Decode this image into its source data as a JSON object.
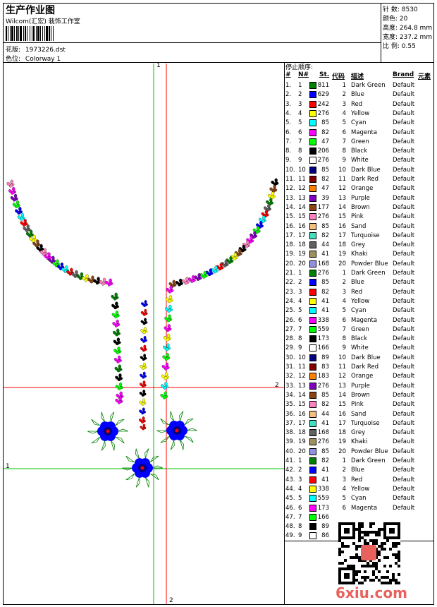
{
  "header": {
    "title": "生产作业图",
    "company": "Wilcom(汇宏) 栽饰工作室",
    "design_label": "花版:",
    "design_value": "1973226.dst",
    "colorway_label": "色位:",
    "colorway_value": "Colorway 1"
  },
  "stats": {
    "stitches_label": "针 数:",
    "stitches_value": "8530",
    "colors_label": "颜色:",
    "colors_value": "20",
    "height_label": "高度:",
    "height_value": "264.8 mm",
    "width_label": "宽度:",
    "width_value": "237.2 mm",
    "scale_label": "比 例:",
    "scale_value": "0.55"
  },
  "axes": {
    "v1": "1",
    "h2": "2",
    "h1": "1",
    "v2": "2"
  },
  "table": {
    "title": "停止顺序:",
    "headers": [
      "#",
      "N#",
      "St.",
      "代码",
      "描述",
      "Brand",
      "元素"
    ],
    "rows": [
      {
        "no": "1.",
        "n": "1",
        "st": "811",
        "code": "1",
        "desc": "Dark Green",
        "brand": "Default",
        "color": "#008000"
      },
      {
        "no": "2.",
        "n": "2",
        "st": "629",
        "code": "2",
        "desc": "Blue",
        "brand": "Default",
        "color": "#0000ff"
      },
      {
        "no": "3.",
        "n": "3",
        "st": "242",
        "code": "3",
        "desc": "Red",
        "brand": "Default",
        "color": "#ff0000"
      },
      {
        "no": "4.",
        "n": "4",
        "st": "276",
        "code": "4",
        "desc": "Yellow",
        "brand": "Default",
        "color": "#ffff00"
      },
      {
        "no": "5.",
        "n": "5",
        "st": "85",
        "code": "5",
        "desc": "Cyan",
        "brand": "Default",
        "color": "#00ffff"
      },
      {
        "no": "6.",
        "n": "6",
        "st": "82",
        "code": "6",
        "desc": "Magenta",
        "brand": "Default",
        "color": "#ff00ff"
      },
      {
        "no": "7.",
        "n": "7",
        "st": "47",
        "code": "7",
        "desc": "Green",
        "brand": "Default",
        "color": "#00ff00"
      },
      {
        "no": "8.",
        "n": "8",
        "st": "206",
        "code": "8",
        "desc": "Black",
        "brand": "Default",
        "color": "#000000"
      },
      {
        "no": "9.",
        "n": "9",
        "st": "276",
        "code": "9",
        "desc": "White",
        "brand": "Default",
        "color": "#ffffff"
      },
      {
        "no": "10.",
        "n": "10",
        "st": "85",
        "code": "10",
        "desc": "Dark Blue",
        "brand": "Default",
        "color": "#000080"
      },
      {
        "no": "11.",
        "n": "11",
        "st": "82",
        "code": "11",
        "desc": "Dark Red",
        "brand": "Default",
        "color": "#800000"
      },
      {
        "no": "12.",
        "n": "12",
        "st": "47",
        "code": "12",
        "desc": "Orange",
        "brand": "Default",
        "color": "#ff8000"
      },
      {
        "no": "13.",
        "n": "13",
        "st": "39",
        "code": "13",
        "desc": "Purple",
        "brand": "Default",
        "color": "#8000c0"
      },
      {
        "no": "14.",
        "n": "14",
        "st": "177",
        "code": "14",
        "desc": "Brown",
        "brand": "Default",
        "color": "#8b4513"
      },
      {
        "no": "15.",
        "n": "15",
        "st": "276",
        "code": "15",
        "desc": "Pink",
        "brand": "Default",
        "color": "#ff80c0"
      },
      {
        "no": "16.",
        "n": "16",
        "st": "85",
        "code": "16",
        "desc": "Sand",
        "brand": "Default",
        "color": "#f4c080"
      },
      {
        "no": "17.",
        "n": "17",
        "st": "82",
        "code": "17",
        "desc": "Turquoise",
        "brand": "Default",
        "color": "#40e0c0"
      },
      {
        "no": "18.",
        "n": "18",
        "st": "44",
        "code": "18",
        "desc": "Grey",
        "brand": "Default",
        "color": "#606060"
      },
      {
        "no": "19.",
        "n": "19",
        "st": "41",
        "code": "19",
        "desc": "Khaki",
        "brand": "Default",
        "color": "#a09060"
      },
      {
        "no": "20.",
        "n": "20",
        "st": "168",
        "code": "20",
        "desc": "Powder Blue",
        "brand": "Default",
        "color": "#9090e0"
      },
      {
        "no": "21.",
        "n": "1",
        "st": "276",
        "code": "1",
        "desc": "Dark Green",
        "brand": "Default",
        "color": "#008000"
      },
      {
        "no": "22.",
        "n": "2",
        "st": "85",
        "code": "2",
        "desc": "Blue",
        "brand": "Default",
        "color": "#0000ff"
      },
      {
        "no": "23.",
        "n": "3",
        "st": "82",
        "code": "3",
        "desc": "Red",
        "brand": "Default",
        "color": "#ff0000"
      },
      {
        "no": "24.",
        "n": "4",
        "st": "41",
        "code": "4",
        "desc": "Yellow",
        "brand": "Default",
        "color": "#ffff00"
      },
      {
        "no": "25.",
        "n": "5",
        "st": "41",
        "code": "5",
        "desc": "Cyan",
        "brand": "Default",
        "color": "#00ffff"
      },
      {
        "no": "26.",
        "n": "6",
        "st": "338",
        "code": "6",
        "desc": "Magenta",
        "brand": "Default",
        "color": "#ff00ff"
      },
      {
        "no": "27.",
        "n": "7",
        "st": "559",
        "code": "7",
        "desc": "Green",
        "brand": "Default",
        "color": "#00ff00"
      },
      {
        "no": "28.",
        "n": "8",
        "st": "173",
        "code": "8",
        "desc": "Black",
        "brand": "Default",
        "color": "#000000"
      },
      {
        "no": "29.",
        "n": "9",
        "st": "166",
        "code": "9",
        "desc": "White",
        "brand": "Default",
        "color": "#ffffff"
      },
      {
        "no": "30.",
        "n": "10",
        "st": "89",
        "code": "10",
        "desc": "Dark Blue",
        "brand": "Default",
        "color": "#000080"
      },
      {
        "no": "31.",
        "n": "11",
        "st": "83",
        "code": "11",
        "desc": "Dark Red",
        "brand": "Default",
        "color": "#800000"
      },
      {
        "no": "32.",
        "n": "12",
        "st": "183",
        "code": "12",
        "desc": "Orange",
        "brand": "Default",
        "color": "#ff8000"
      },
      {
        "no": "33.",
        "n": "13",
        "st": "276",
        "code": "13",
        "desc": "Purple",
        "brand": "Default",
        "color": "#8000c0"
      },
      {
        "no": "34.",
        "n": "14",
        "st": "85",
        "code": "14",
        "desc": "Brown",
        "brand": "Default",
        "color": "#8b4513"
      },
      {
        "no": "35.",
        "n": "15",
        "st": "82",
        "code": "15",
        "desc": "Pink",
        "brand": "Default",
        "color": "#ff80c0"
      },
      {
        "no": "36.",
        "n": "16",
        "st": "44",
        "code": "16",
        "desc": "Sand",
        "brand": "Default",
        "color": "#f4c080"
      },
      {
        "no": "37.",
        "n": "17",
        "st": "41",
        "code": "17",
        "desc": "Turquoise",
        "brand": "Default",
        "color": "#40e0c0"
      },
      {
        "no": "38.",
        "n": "18",
        "st": "168",
        "code": "18",
        "desc": "Grey",
        "brand": "Default",
        "color": "#606060"
      },
      {
        "no": "39.",
        "n": "19",
        "st": "276",
        "code": "19",
        "desc": "Khaki",
        "brand": "Default",
        "color": "#a09060"
      },
      {
        "no": "40.",
        "n": "20",
        "st": "85",
        "code": "20",
        "desc": "Powder Blue",
        "brand": "Default",
        "color": "#9090e0"
      },
      {
        "no": "41.",
        "n": "1",
        "st": "82",
        "code": "1",
        "desc": "Dark Green",
        "brand": "Default",
        "color": "#008000"
      },
      {
        "no": "42.",
        "n": "2",
        "st": "41",
        "code": "2",
        "desc": "Blue",
        "brand": "Default",
        "color": "#0000ff"
      },
      {
        "no": "43.",
        "n": "3",
        "st": "41",
        "code": "3",
        "desc": "Red",
        "brand": "Default",
        "color": "#ff0000"
      },
      {
        "no": "44.",
        "n": "4",
        "st": "338",
        "code": "4",
        "desc": "Yellow",
        "brand": "Default",
        "color": "#ffff00"
      },
      {
        "no": "45.",
        "n": "5",
        "st": "559",
        "code": "5",
        "desc": "Cyan",
        "brand": "Default",
        "color": "#00ffff"
      },
      {
        "no": "46.",
        "n": "6",
        "st": "173",
        "code": "6",
        "desc": "Magenta",
        "brand": "Default",
        "color": "#ff00ff"
      },
      {
        "no": "47.",
        "n": "7",
        "st": "166",
        "code": "",
        "desc": "",
        "brand": "",
        "color": "#00ff00"
      },
      {
        "no": "48.",
        "n": "8",
        "st": "89",
        "code": "",
        "desc": "",
        "brand": "",
        "color": "#000000"
      },
      {
        "no": "49.",
        "n": "9",
        "st": "86",
        "code": "",
        "desc": "",
        "brand": "",
        "color": "#ffffff"
      }
    ]
  },
  "watermark": {
    "text": "6xiu",
    "suffix": ".com"
  },
  "colors": {
    "axis_green": "#00c000",
    "axis_red": "#ff0000"
  }
}
